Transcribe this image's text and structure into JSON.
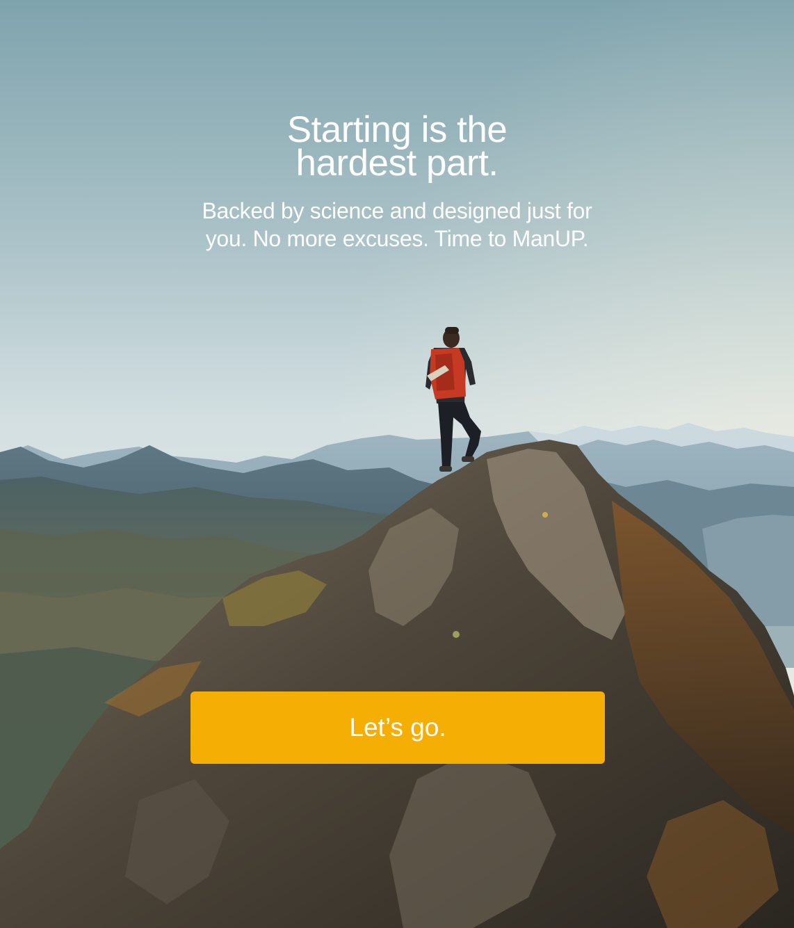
{
  "onboarding": {
    "headline": "Starting is the\nhardest part.",
    "subtitle": "Backed by science and designed just for\nyou. No more excuses. Time to ManUP.",
    "cta_label": "Let’s go."
  },
  "colors": {
    "cta_background": "#f5ae03",
    "text": "#ffffff",
    "sky_top": "#7ea2ac",
    "sky_bottom": "#d8e2e3"
  }
}
